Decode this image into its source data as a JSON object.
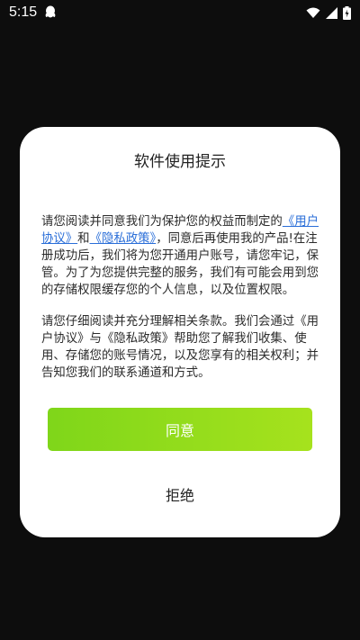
{
  "status_bar": {
    "time": "5:15",
    "icons": [
      "qq-icon",
      "wifi-icon",
      "signal-icon",
      "battery-charging-icon"
    ]
  },
  "dialog": {
    "title": "软件使用提示",
    "paragraph1": {
      "text_before": "请您阅读并同意我们为保护您的权益而制定的",
      "link_user_agreement": "《用户协议》",
      "text_and": "和",
      "link_privacy_policy": "《隐私政策》",
      "text_after": "，同意后再使用我的产品!在注册成功后，我们将为您开通用户账号，请您牢记，保管。为了为您提供完整的服务，我们有可能会用到您的存储权限缓存您的个人信息，以及位置权限。"
    },
    "paragraph2": "请您仔细阅读并充分理解相关条款。我们会通过《用户协议》与《隐私政策》帮助您了解我们收集、使用、存储您的账号情况，以及您享有的相关权利；并告知您我们的联系通道和方式。",
    "agree_label": "同意",
    "refuse_label": "拒绝"
  },
  "colors": {
    "background": "#0d0d0d",
    "accent_start": "#7fd61a",
    "accent_end": "#a6e21d",
    "link": "#2a6ed8"
  }
}
